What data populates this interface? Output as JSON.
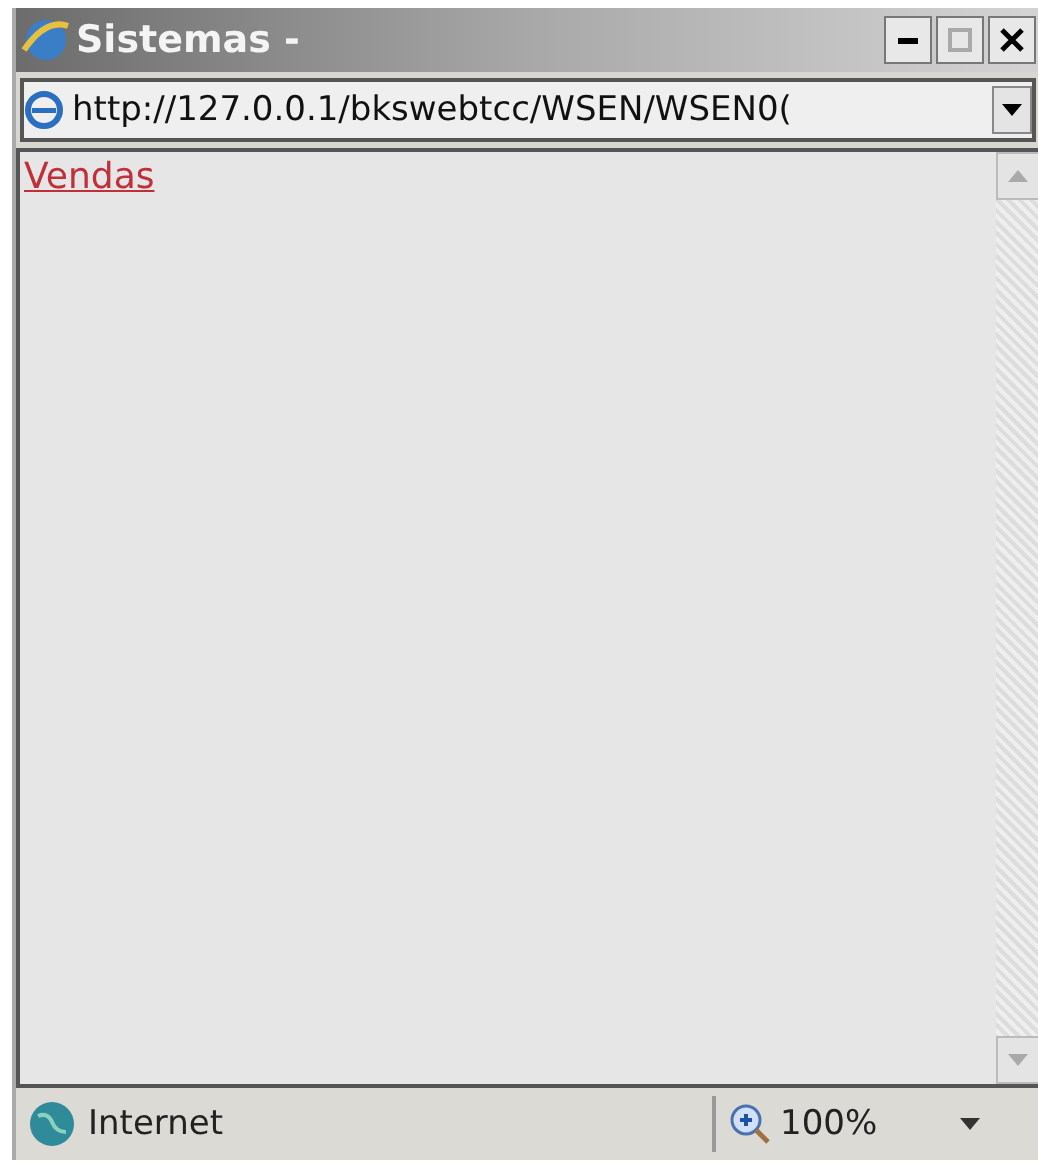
{
  "window": {
    "title": "Sistemas -"
  },
  "address_bar": {
    "url": "http://127.0.0.1/bkswebtcc/WSEN/WSEN0("
  },
  "content": {
    "links": [
      "Vendas"
    ]
  },
  "status_bar": {
    "zone": "Internet",
    "zoom": "100%"
  }
}
